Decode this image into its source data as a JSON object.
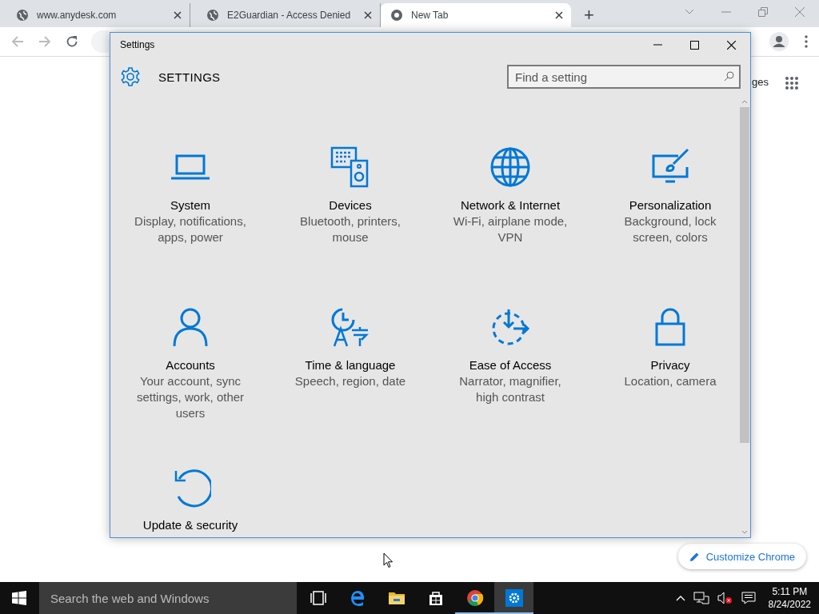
{
  "browser": {
    "tabs": [
      {
        "title": "www.anydesk.com",
        "selected": false
      },
      {
        "title": "E2Guardian - Access Denied",
        "selected": false
      },
      {
        "title": "New Tab",
        "selected": true
      }
    ],
    "new_tab": "+",
    "page_link": "ges",
    "customize_button": "Customize Chrome"
  },
  "settings_window": {
    "title": "Settings",
    "heading": "SETTINGS",
    "search": {
      "placeholder": "Find a setting"
    },
    "categories": [
      {
        "title": "System",
        "description": "Display, notifications, apps, power"
      },
      {
        "title": "Devices",
        "description": "Bluetooth, printers, mouse"
      },
      {
        "title": "Network & Internet",
        "description": "Wi-Fi, airplane mode, VPN"
      },
      {
        "title": "Personalization",
        "description": "Background, lock screen, colors"
      },
      {
        "title": "Accounts",
        "description": "Your account, sync settings, work, other users"
      },
      {
        "title": "Time & language",
        "description": "Speech, region, date"
      },
      {
        "title": "Ease of Access",
        "description": "Narrator, magnifier, high contrast"
      },
      {
        "title": "Privacy",
        "description": "Location, camera"
      },
      {
        "title": "Update & security"
      }
    ]
  },
  "taskbar": {
    "search": {
      "placeholder": "Search the web and Windows"
    },
    "apps": [
      {
        "selected": false,
        "running": false
      },
      {
        "selected": false,
        "running": false
      },
      {
        "selected": false,
        "running": false
      },
      {
        "selected": false,
        "running": false
      },
      {
        "selected": false,
        "running": true
      },
      {
        "selected": true,
        "running": true
      }
    ],
    "time": "5:11 PM",
    "date": "8/24/2022"
  }
}
